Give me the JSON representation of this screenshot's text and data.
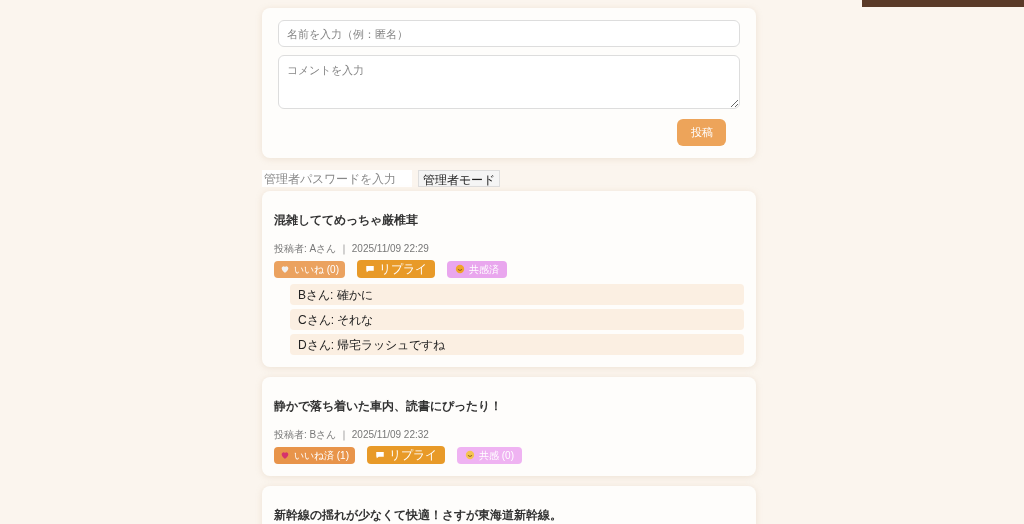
{
  "form": {
    "name_placeholder": "名前を入力（例：匿名）",
    "comment_placeholder": "コメントを入力",
    "submit": "投稿"
  },
  "admin": {
    "password_placeholder": "管理者パスワードを入力",
    "mode_button": "管理者モード"
  },
  "posts": [
    {
      "text": "混雑しててめっちゃ厳椎茸",
      "meta": "投稿者: Aさん ｜ 2025/11/09 22:29",
      "like": {
        "label": "いいね (0)",
        "liked": false
      },
      "reply": "リプライ",
      "empathy": {
        "label": "共感済",
        "reacted": true
      },
      "replies": [
        "Bさん: 確かに",
        "Cさん: それな",
        "Dさん: 帰宅ラッシュですね"
      ]
    },
    {
      "text": "静かで落ち着いた車内、読書にぴったり！",
      "meta": "投稿者: Bさん ｜ 2025/11/09 22:32",
      "like": {
        "label": "いいね済 (1)",
        "liked": true
      },
      "reply": "リプライ",
      "empathy": {
        "label": "共感 (0)",
        "reacted": false
      }
    },
    {
      "text": "新幹線の揺れが少なくて快適！さすが東海道新幹線。"
    }
  ]
}
